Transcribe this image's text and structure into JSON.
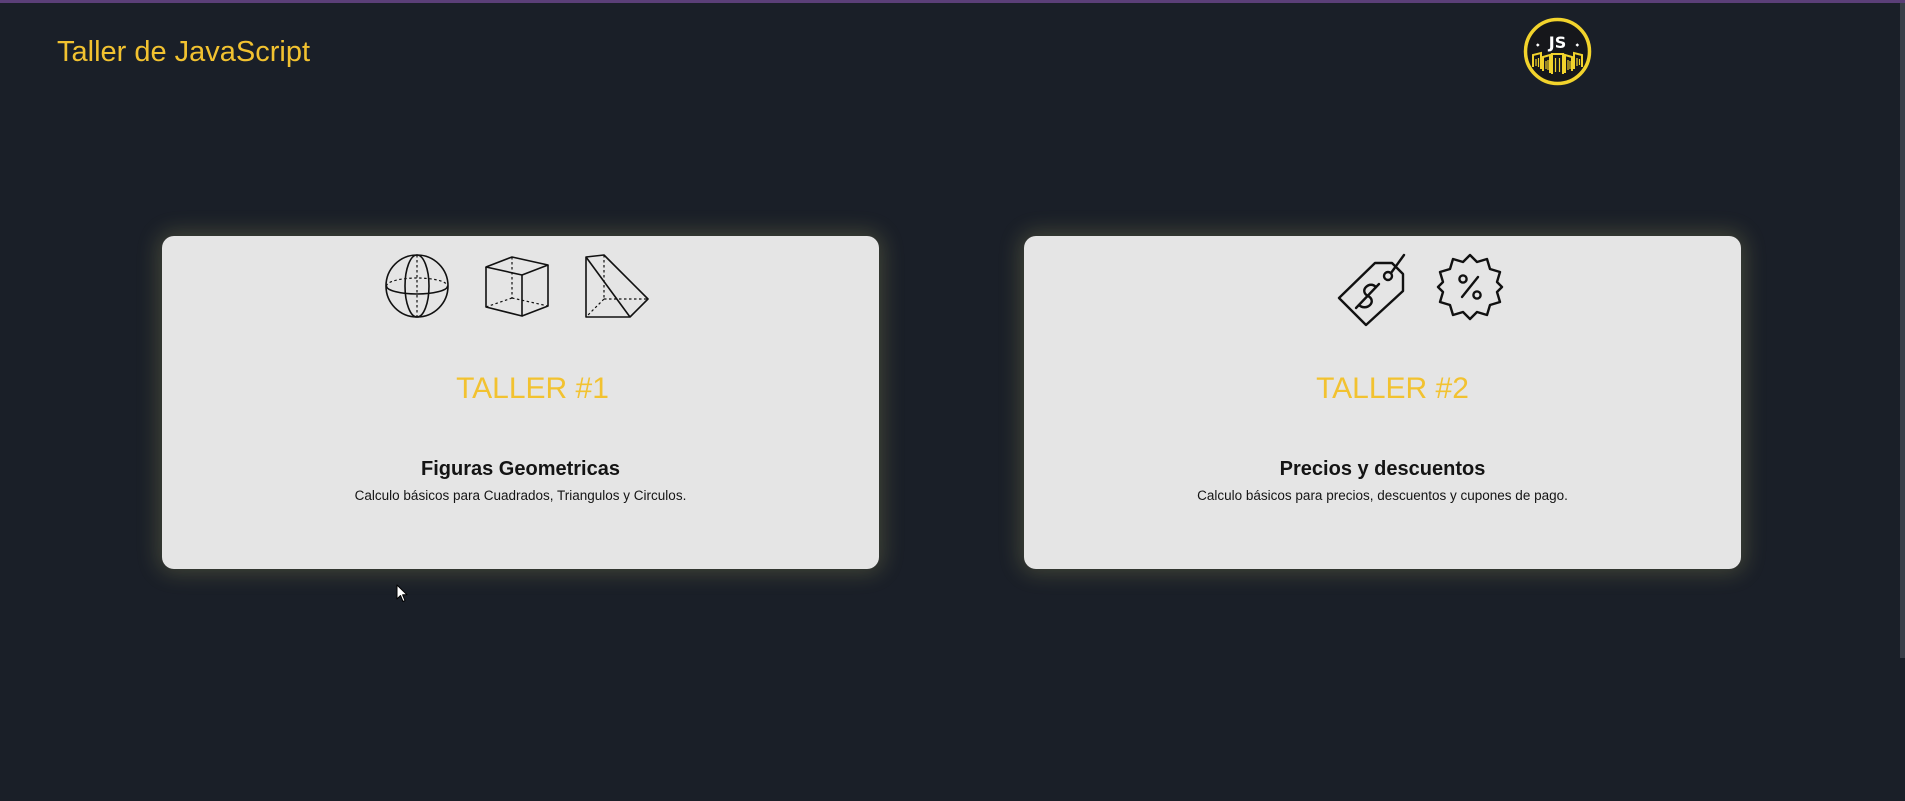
{
  "header": {
    "title": "Taller de JavaScript",
    "logo_text": "JS"
  },
  "cards": [
    {
      "heading": "TALLER #1",
      "subtitle": "Figuras Geometricas",
      "description": "Calculo básicos para Cuadrados, Triangulos y Circulos.",
      "icons": [
        "sphere-icon",
        "cube-icon",
        "prism-icon"
      ]
    },
    {
      "heading": "TALLER #2",
      "subtitle": "Precios y descuentos",
      "description": "Calculo básicos para precios, descuentos y cupones de pago.",
      "icons": [
        "price-tag-icon",
        "discount-badge-icon"
      ]
    }
  ],
  "colors": {
    "background": "#1a1f28",
    "accent": "#f2c230",
    "card": "#e5e5e5",
    "top_strip": "#5b3f78"
  }
}
